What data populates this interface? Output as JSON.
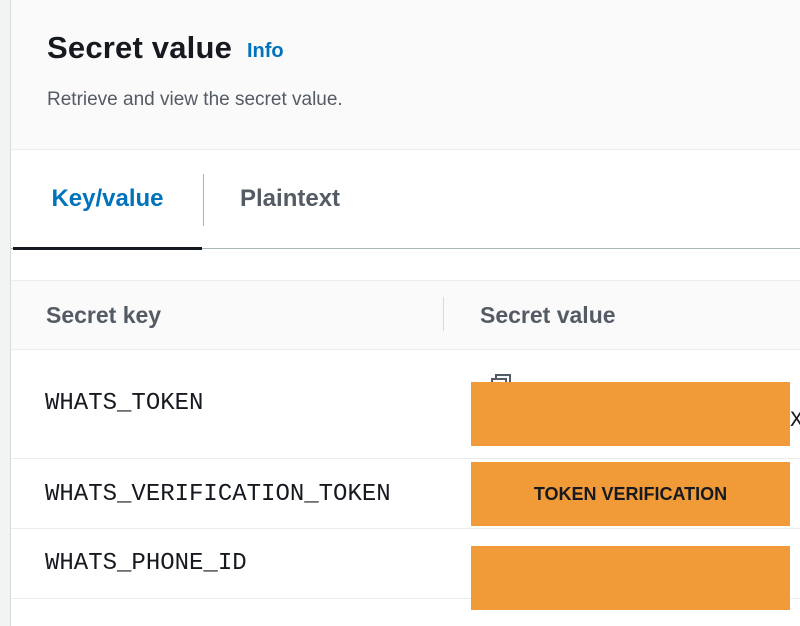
{
  "header": {
    "title": "Secret value",
    "info_link": "Info",
    "description": "Retrieve and view the secret value."
  },
  "tabs": [
    {
      "label": "Key/value",
      "active": true
    },
    {
      "label": "Plaintext",
      "active": false
    }
  ],
  "table": {
    "columns": [
      "Secret key",
      "Secret value"
    ],
    "rows": [
      {
        "key": "WHATS_TOKEN",
        "value_label": ""
      },
      {
        "key": "WHATS_VERIFICATION_TOKEN",
        "value_label": "TOKEN VERIFICATION"
      },
      {
        "key": "WHATS_PHONE_ID",
        "value_label": ""
      }
    ]
  },
  "overflow_text": "X",
  "colors": {
    "accent": "#0073bb",
    "redaction": "#f19b38"
  },
  "icons": {
    "copy": "copy-icon"
  }
}
